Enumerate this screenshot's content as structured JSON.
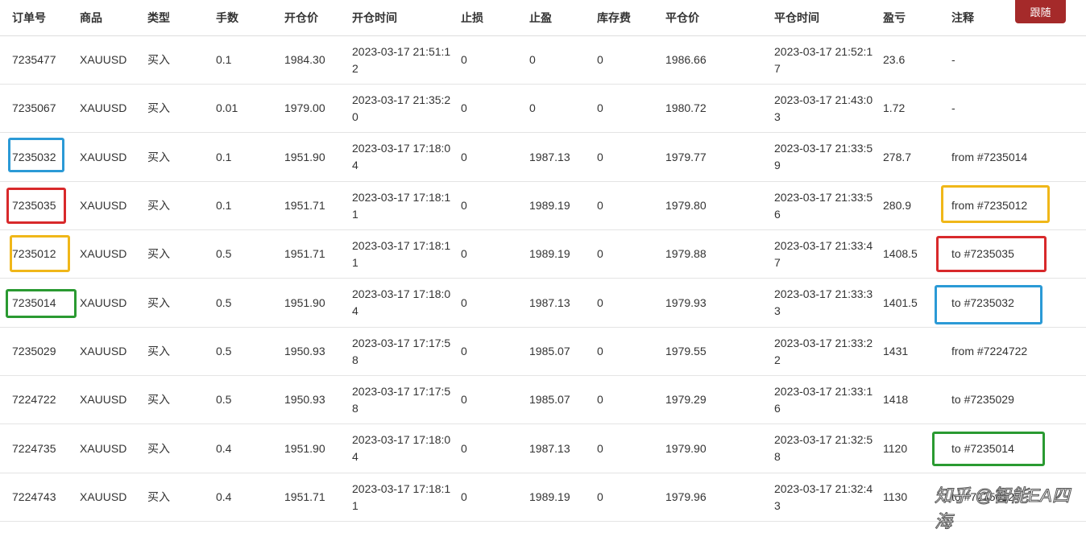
{
  "header": {
    "order": "订单号",
    "symbol": "商品",
    "type": "类型",
    "lots": "手数",
    "open_price": "开仓价",
    "open_time": "开仓时间",
    "stop_loss": "止损",
    "take_profit": "止盈",
    "swap": "库存费",
    "close_price": "平仓价",
    "close_time": "平仓时间",
    "profit": "盈亏",
    "comment": "注释"
  },
  "follow_button": "跟随",
  "rows": [
    {
      "order": "7235477",
      "symbol": "XAUUSD",
      "type": "买入",
      "lots": "0.1",
      "open_price": "1984.30",
      "open_time": "2023-03-17 21:51:12",
      "sl": "0",
      "tp": "0",
      "swap": "0",
      "close_price": "1986.66",
      "close_time": "2023-03-17 21:52:17",
      "profit": "23.6",
      "comment": "-"
    },
    {
      "order": "7235067",
      "symbol": "XAUUSD",
      "type": "买入",
      "lots": "0.01",
      "open_price": "1979.00",
      "open_time": "2023-03-17 21:35:20",
      "sl": "0",
      "tp": "0",
      "swap": "0",
      "close_price": "1980.72",
      "close_time": "2023-03-17 21:43:03",
      "profit": "1.72",
      "comment": "-"
    },
    {
      "order": "7235032",
      "symbol": "XAUUSD",
      "type": "买入",
      "lots": "0.1",
      "open_price": "1951.90",
      "open_time": "2023-03-17 17:18:04",
      "sl": "0",
      "tp": "1987.13",
      "swap": "0",
      "close_price": "1979.77",
      "close_time": "2023-03-17 21:33:59",
      "profit": "278.7",
      "comment": "from #7235014"
    },
    {
      "order": "7235035",
      "symbol": "XAUUSD",
      "type": "买入",
      "lots": "0.1",
      "open_price": "1951.71",
      "open_time": "2023-03-17 17:18:11",
      "sl": "0",
      "tp": "1989.19",
      "swap": "0",
      "close_price": "1979.80",
      "close_time": "2023-03-17 21:33:56",
      "profit": "280.9",
      "comment": "from #7235012"
    },
    {
      "order": "7235012",
      "symbol": "XAUUSD",
      "type": "买入",
      "lots": "0.5",
      "open_price": "1951.71",
      "open_time": "2023-03-17 17:18:11",
      "sl": "0",
      "tp": "1989.19",
      "swap": "0",
      "close_price": "1979.88",
      "close_time": "2023-03-17 21:33:47",
      "profit": "1408.5",
      "comment": "to #7235035"
    },
    {
      "order": "7235014",
      "symbol": "XAUUSD",
      "type": "买入",
      "lots": "0.5",
      "open_price": "1951.90",
      "open_time": "2023-03-17 17:18:04",
      "sl": "0",
      "tp": "1987.13",
      "swap": "0",
      "close_price": "1979.93",
      "close_time": "2023-03-17 21:33:33",
      "profit": "1401.5",
      "comment": "to #7235032"
    },
    {
      "order": "7235029",
      "symbol": "XAUUSD",
      "type": "买入",
      "lots": "0.5",
      "open_price": "1950.93",
      "open_time": "2023-03-17 17:17:58",
      "sl": "0",
      "tp": "1985.07",
      "swap": "0",
      "close_price": "1979.55",
      "close_time": "2023-03-17 21:33:22",
      "profit": "1431",
      "comment": "from #7224722"
    },
    {
      "order": "7224722",
      "symbol": "XAUUSD",
      "type": "买入",
      "lots": "0.5",
      "open_price": "1950.93",
      "open_time": "2023-03-17 17:17:58",
      "sl": "0",
      "tp": "1985.07",
      "swap": "0",
      "close_price": "1979.29",
      "close_time": "2023-03-17 21:33:16",
      "profit": "1418",
      "comment": "to #7235029"
    },
    {
      "order": "7224735",
      "symbol": "XAUUSD",
      "type": "买入",
      "lots": "0.4",
      "open_price": "1951.90",
      "open_time": "2023-03-17 17:18:04",
      "sl": "0",
      "tp": "1987.13",
      "swap": "0",
      "close_price": "1979.90",
      "close_time": "2023-03-17 21:32:58",
      "profit": "1120",
      "comment": "to #7235014"
    },
    {
      "order": "7224743",
      "symbol": "XAUUSD",
      "type": "买入",
      "lots": "0.4",
      "open_price": "1951.71",
      "open_time": "2023-03-17 17:18:11",
      "sl": "0",
      "tp": "1989.19",
      "swap": "0",
      "close_price": "1979.96",
      "close_time": "2023-03-17 21:32:43",
      "profit": "1130",
      "comment": "to #7235012"
    }
  ],
  "annotation_colors": {
    "blue": "#2b9ad6",
    "red": "#d8292b",
    "yellow": "#f0b719",
    "green": "#2a9a31"
  },
  "watermark": "知乎 @智能EA四海"
}
